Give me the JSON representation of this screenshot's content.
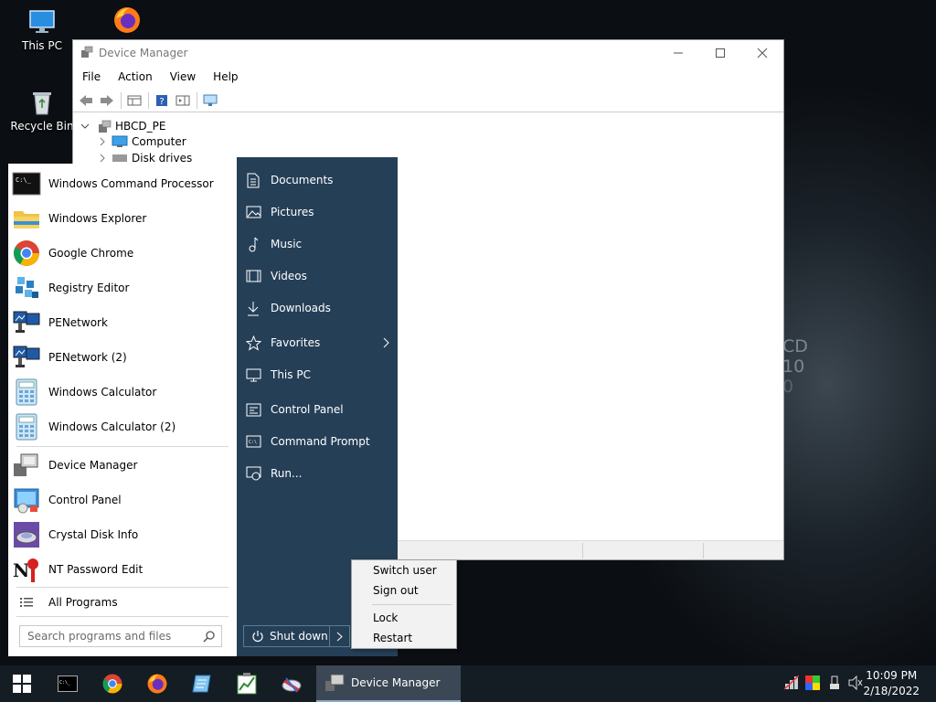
{
  "desktop": {
    "icons": [
      {
        "label": "This PC",
        "icon": "this-pc-icon"
      },
      {
        "label": "",
        "icon": "firefox-icon"
      },
      {
        "label": "Recycle Bin",
        "icon": "recycle-bin-icon"
      }
    ],
    "watermark": [
      "CD",
      "10",
      "0"
    ]
  },
  "device_manager": {
    "title": "Device Manager",
    "menu": [
      "File",
      "Action",
      "View",
      "Help"
    ],
    "tree": [
      {
        "label": "HBCD_PE",
        "expanded": true
      },
      {
        "label": "Computer",
        "expanded": false
      },
      {
        "label": "Disk drives",
        "expanded": false
      }
    ]
  },
  "start_menu": {
    "pinned": [
      {
        "label": "Windows Command Processor",
        "icon": "cmd-icon"
      },
      {
        "label": "Windows Explorer",
        "icon": "folder-icon"
      },
      {
        "label": "Google Chrome",
        "icon": "chrome-icon"
      },
      {
        "label": "Registry Editor",
        "icon": "registry-icon"
      },
      {
        "label": "PENetwork",
        "icon": "network-icon"
      },
      {
        "label": "PENetwork (2)",
        "icon": "network-icon"
      },
      {
        "label": "Windows Calculator",
        "icon": "calculator-icon"
      },
      {
        "label": "Windows Calculator (2)",
        "icon": "calculator-icon"
      }
    ],
    "recent": [
      {
        "label": "Device Manager",
        "icon": "device-manager-icon"
      },
      {
        "label": "Control Panel",
        "icon": "control-panel-icon"
      },
      {
        "label": "Crystal Disk Info",
        "icon": "disk-info-icon"
      },
      {
        "label": "NT Password Edit",
        "icon": "password-icon"
      }
    ],
    "all_programs": "All Programs",
    "search_placeholder": "Search programs and files",
    "places": [
      {
        "label": "Documents",
        "icon": "document-icon"
      },
      {
        "label": "Pictures",
        "icon": "pictures-icon"
      },
      {
        "label": "Music",
        "icon": "music-icon"
      },
      {
        "label": "Videos",
        "icon": "videos-icon"
      },
      {
        "label": "Downloads",
        "icon": "download-icon"
      },
      {
        "label": "Favorites",
        "icon": "star-icon",
        "submenu": true
      },
      {
        "label": "This PC",
        "icon": "monitor-icon"
      },
      {
        "label": "Control Panel",
        "icon": "control-panel-icon"
      },
      {
        "label": "Command Prompt",
        "icon": "cmd-icon"
      },
      {
        "label": "Run...",
        "icon": "run-icon"
      }
    ],
    "shutdown_label": "Shut down"
  },
  "power_menu": {
    "items": [
      "Switch user",
      "Sign out",
      "Lock",
      "Restart"
    ]
  },
  "taskbar": {
    "active_task": "Device Manager",
    "time": "10:09 PM",
    "date": "2/18/2022"
  },
  "colors": {
    "start_right_panel": "#253f57",
    "taskbar": "#141c24",
    "active_task": "#3b4754"
  }
}
